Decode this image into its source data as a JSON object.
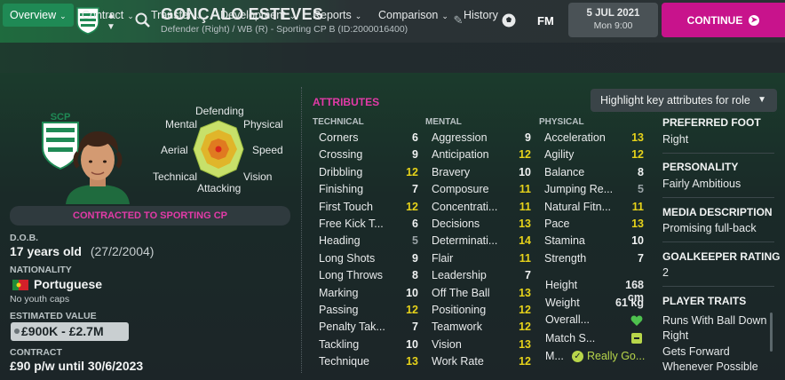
{
  "header": {
    "player_name": "GONÇALO ESTEVES",
    "subtitle": "Defender (Right) / WB (R) - Sporting CP B (ID:2000016400)",
    "fm_label": "FM",
    "date": "5 JUL 2021",
    "time": "Mon 9:00",
    "continue_label": "CONTINUE"
  },
  "tabs": [
    {
      "label": "Overview"
    },
    {
      "label": "Contract"
    },
    {
      "label": "Transfer"
    },
    {
      "label": "Development"
    },
    {
      "label": "Reports"
    },
    {
      "label": "Comparison"
    },
    {
      "label": "History"
    }
  ],
  "polar": {
    "labels": {
      "defending": "Defending",
      "physical": "Physical",
      "speed": "Speed",
      "vision": "Vision",
      "attacking": "Attacking",
      "technical": "Technical",
      "aerial": "Aerial",
      "mental": "Mental"
    }
  },
  "profile": {
    "contract_banner": "CONTRACTED TO SPORTING CP",
    "dob_label": "D.O.B.",
    "age": "17 years old",
    "dob": "(27/2/2004)",
    "nationality_label": "NATIONALITY",
    "nationality": "Portuguese",
    "caps": "No youth caps",
    "value_label": "ESTIMATED VALUE",
    "value": "£900K - £2.7M",
    "contract_label": "CONTRACT",
    "contract": "£90 p/w until 30/6/2023"
  },
  "attributes": {
    "title": "ATTRIBUTES",
    "highlight_label": "Highlight key attributes for role",
    "technical_header": "TECHNICAL",
    "mental_header": "MENTAL",
    "physical_header": "PHYSICAL",
    "technical": [
      {
        "name": "Corners",
        "value": "6",
        "color": "#f2f4f4"
      },
      {
        "name": "Crossing",
        "value": "9",
        "color": "#f2f4f4"
      },
      {
        "name": "Dribbling",
        "value": "12",
        "color": "#e6d21a"
      },
      {
        "name": "Finishing",
        "value": "7",
        "color": "#f2f4f4"
      },
      {
        "name": "First Touch",
        "value": "12",
        "color": "#e6d21a"
      },
      {
        "name": "Free Kick T...",
        "value": "6",
        "color": "#f2f4f4"
      },
      {
        "name": "Heading",
        "value": "5",
        "color": "#9aa3a6"
      },
      {
        "name": "Long Shots",
        "value": "9",
        "color": "#f2f4f4"
      },
      {
        "name": "Long Throws",
        "value": "8",
        "color": "#f2f4f4"
      },
      {
        "name": "Marking",
        "value": "10",
        "color": "#f2f4f4"
      },
      {
        "name": "Passing",
        "value": "12",
        "color": "#e6d21a"
      },
      {
        "name": "Penalty Tak...",
        "value": "7",
        "color": "#f2f4f4"
      },
      {
        "name": "Tackling",
        "value": "10",
        "color": "#f2f4f4"
      },
      {
        "name": "Technique",
        "value": "13",
        "color": "#e6d21a"
      }
    ],
    "mental": [
      {
        "name": "Aggression",
        "value": "9",
        "color": "#f2f4f4"
      },
      {
        "name": "Anticipation",
        "value": "12",
        "color": "#e6d21a"
      },
      {
        "name": "Bravery",
        "value": "10",
        "color": "#f2f4f4"
      },
      {
        "name": "Composure",
        "value": "11",
        "color": "#e6d21a"
      },
      {
        "name": "Concentrati...",
        "value": "11",
        "color": "#e6d21a"
      },
      {
        "name": "Decisions",
        "value": "13",
        "color": "#e6d21a"
      },
      {
        "name": "Determinati...",
        "value": "14",
        "color": "#e6d21a"
      },
      {
        "name": "Flair",
        "value": "11",
        "color": "#e6d21a"
      },
      {
        "name": "Leadership",
        "value": "7",
        "color": "#f2f4f4"
      },
      {
        "name": "Off The Ball",
        "value": "13",
        "color": "#e6d21a"
      },
      {
        "name": "Positioning",
        "value": "12",
        "color": "#e6d21a"
      },
      {
        "name": "Teamwork",
        "value": "12",
        "color": "#e6d21a"
      },
      {
        "name": "Vision",
        "value": "13",
        "color": "#e6d21a"
      },
      {
        "name": "Work Rate",
        "value": "12",
        "color": "#e6d21a"
      }
    ],
    "physical": [
      {
        "name": "Acceleration",
        "value": "13",
        "color": "#e6d21a"
      },
      {
        "name": "Agility",
        "value": "12",
        "color": "#e6d21a"
      },
      {
        "name": "Balance",
        "value": "8",
        "color": "#f2f4f4"
      },
      {
        "name": "Jumping Re...",
        "value": "5",
        "color": "#9aa3a6"
      },
      {
        "name": "Natural Fitn...",
        "value": "11",
        "color": "#e6d21a"
      },
      {
        "name": "Pace",
        "value": "13",
        "color": "#e6d21a"
      },
      {
        "name": "Stamina",
        "value": "10",
        "color": "#f2f4f4"
      },
      {
        "name": "Strength",
        "value": "7",
        "color": "#f2f4f4"
      }
    ],
    "height_label": "Height",
    "height": "168 cm",
    "weight_label": "Weight",
    "weight": "61 kg",
    "overall_label": "Overall...",
    "match_label": "Match S...",
    "morale_label": "M...",
    "morale_value": "Really Go..."
  },
  "info": {
    "foot_label": "PREFERRED FOOT",
    "foot": "Right",
    "personality_label": "PERSONALITY",
    "personality": "Fairly Ambitious",
    "media_label": "MEDIA DESCRIPTION",
    "media": "Promising full-back",
    "gk_label": "GOALKEEPER RATING",
    "gk": "2",
    "traits_label": "PLAYER TRAITS",
    "trait1": "Runs With Ball Down Right",
    "trait2": "Gets Forward Whenever Possible"
  }
}
